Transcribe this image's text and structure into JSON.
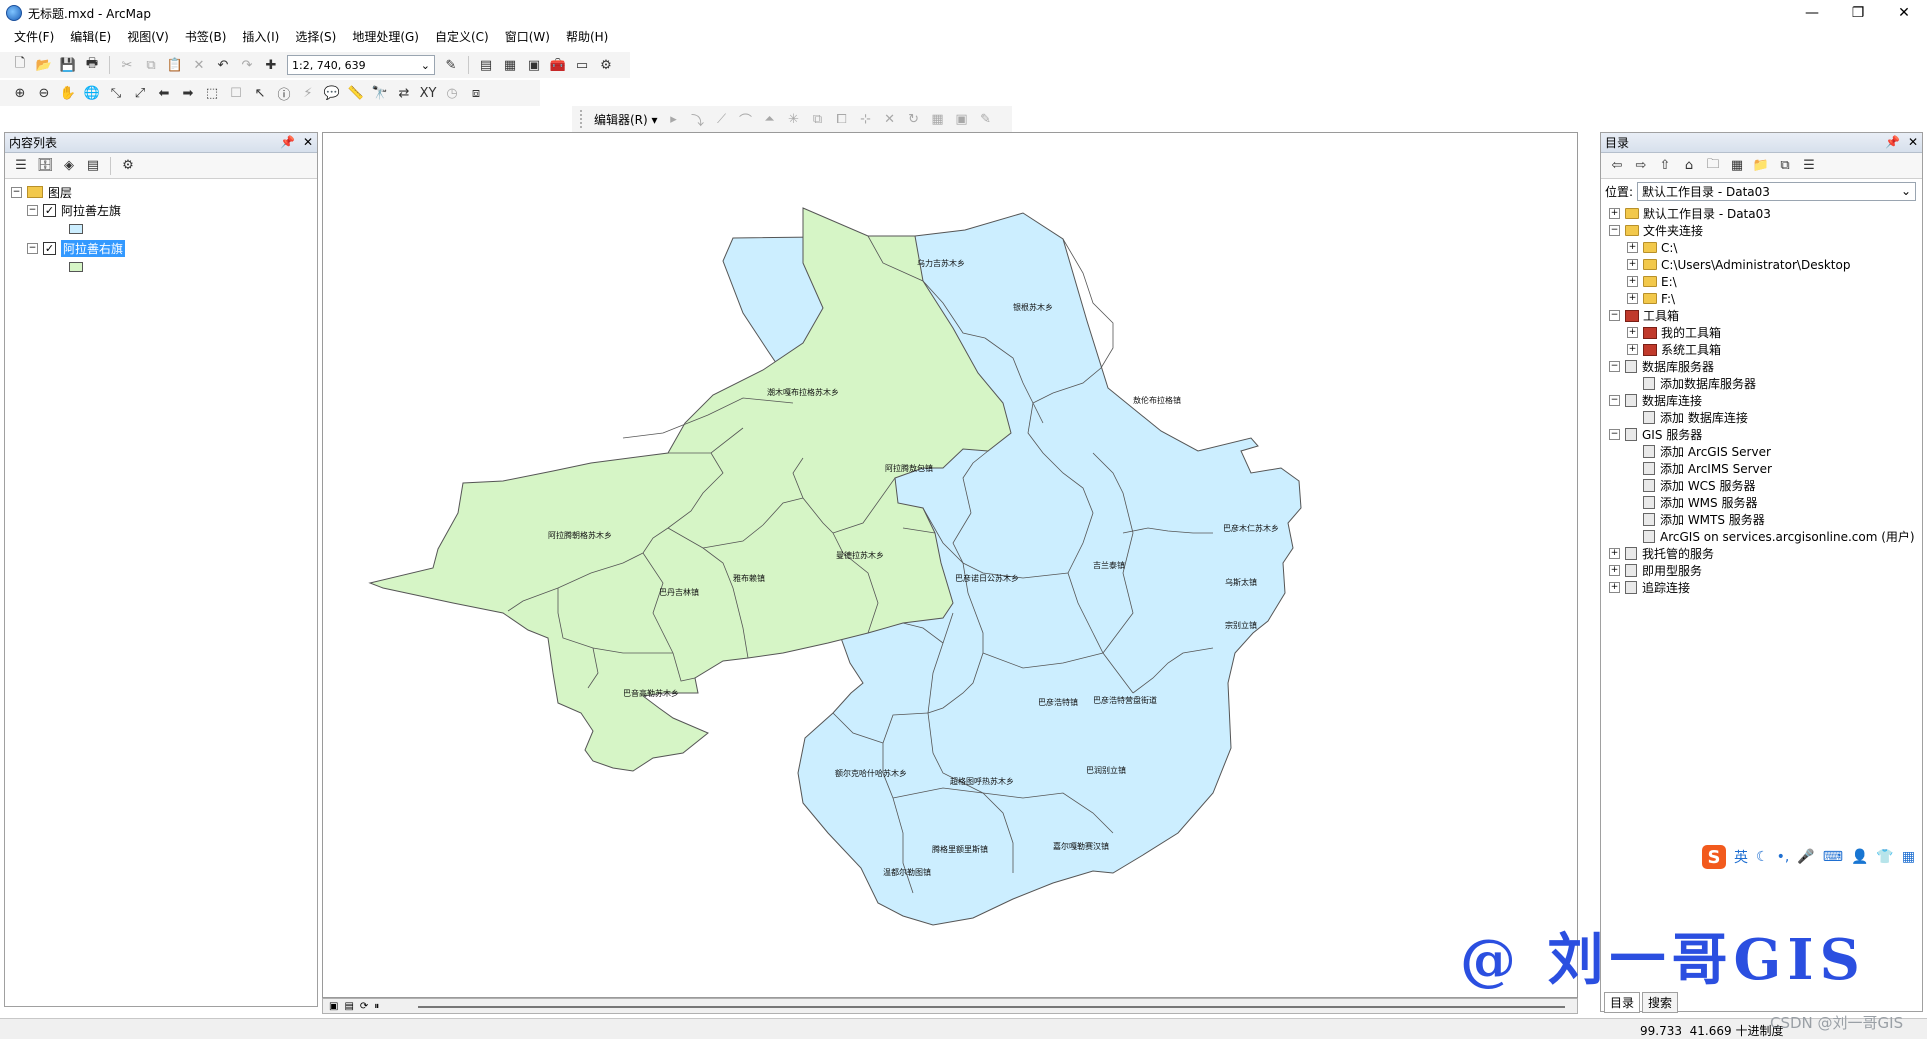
{
  "window": {
    "title": "无标题.mxd - ArcMap",
    "minimize": "—",
    "restore": "❐",
    "close": "✕"
  },
  "menu": [
    "文件(F)",
    "编辑(E)",
    "视图(V)",
    "书签(B)",
    "插入(I)",
    "选择(S)",
    "地理处理(G)",
    "自定义(C)",
    "窗口(W)",
    "帮助(H)"
  ],
  "toolbar": {
    "scale": "1:2, 740, 639",
    "editor_label": "编辑器(R) ▾"
  },
  "toc": {
    "title": "内容列表",
    "root_label": "图层",
    "layers": [
      {
        "name": "阿拉善左旗",
        "checked": true,
        "swatch": "#cceeff"
      },
      {
        "name": "阿拉善右旗",
        "checked": true,
        "swatch": "#d6f5c6",
        "selected": true
      }
    ]
  },
  "map": {
    "left_banner_color": "#d6f5c6",
    "right_banner_color": "#cceeff",
    "labels": [
      "乌力吉苏木乡",
      "银根苏木乡",
      "敖伦布拉格镇",
      "潮木嘎布拉格苏木乡",
      "阿拉腾敖包镇",
      "阿拉腾朝格苏木乡",
      "雅布赖镇",
      "曼德拉苏木乡",
      "巴丹吉林镇",
      "巴音高勒苏木乡",
      "巴彦诺日公苏木乡",
      "吉兰泰镇",
      "巴彦木仁苏木乡",
      "乌斯太镇",
      "宗别立镇",
      "巴彦浩特镇",
      "巴彦浩特营盘街道",
      "额尔克哈什哈苏木乡",
      "超格图呼热苏木乡",
      "巴润别立镇",
      "腾格里额里斯镇",
      "嘉尔嘎勒赛汉镇",
      "温都尔勒图镇"
    ]
  },
  "catalog": {
    "title": "目录",
    "location_label": "位置:",
    "location_value": "默认工作目录 - Data03",
    "items": [
      {
        "label": "默认工作目录 - Data03",
        "level": 0,
        "icon": "folder",
        "exp": "+"
      },
      {
        "label": "文件夹连接",
        "level": 0,
        "icon": "folder",
        "exp": "−"
      },
      {
        "label": "C:\\",
        "level": 1,
        "icon": "folder",
        "exp": "+"
      },
      {
        "label": "C:\\Users\\Administrator\\Desktop",
        "level": 1,
        "icon": "folder",
        "exp": "+"
      },
      {
        "label": "E:\\",
        "level": 1,
        "icon": "folder",
        "exp": "+"
      },
      {
        "label": "F:\\",
        "level": 1,
        "icon": "folder",
        "exp": "+"
      },
      {
        "label": "工具箱",
        "level": 0,
        "icon": "toolbox",
        "exp": "−"
      },
      {
        "label": "我的工具箱",
        "level": 1,
        "icon": "toolbox",
        "exp": "+"
      },
      {
        "label": "系统工具箱",
        "level": 1,
        "icon": "toolbox",
        "exp": "+"
      },
      {
        "label": "数据库服务器",
        "level": 0,
        "icon": "server",
        "exp": "−"
      },
      {
        "label": "添加数据库服务器",
        "level": 1,
        "icon": "server",
        "exp": ""
      },
      {
        "label": "数据库连接",
        "level": 0,
        "icon": "server",
        "exp": "−"
      },
      {
        "label": "添加 数据库连接",
        "level": 1,
        "icon": "server",
        "exp": ""
      },
      {
        "label": "GIS 服务器",
        "level": 0,
        "icon": "server",
        "exp": "−"
      },
      {
        "label": "添加 ArcGIS Server",
        "level": 1,
        "icon": "server",
        "exp": ""
      },
      {
        "label": "添加 ArcIMS Server",
        "level": 1,
        "icon": "server",
        "exp": ""
      },
      {
        "label": "添加 WCS 服务器",
        "level": 1,
        "icon": "server",
        "exp": ""
      },
      {
        "label": "添加 WMS 服务器",
        "level": 1,
        "icon": "server",
        "exp": ""
      },
      {
        "label": "添加 WMTS 服务器",
        "level": 1,
        "icon": "server",
        "exp": ""
      },
      {
        "label": "ArcGIS on services.arcgisonline.com (用户)",
        "level": 1,
        "icon": "server",
        "exp": ""
      },
      {
        "label": "我托管的服务",
        "level": 0,
        "icon": "server",
        "exp": "+"
      },
      {
        "label": "即用型服务",
        "level": 0,
        "icon": "server",
        "exp": "+"
      },
      {
        "label": "追踪连接",
        "level": 0,
        "icon": "server",
        "exp": "+"
      }
    ],
    "tabs": [
      "目录",
      "搜索"
    ]
  },
  "status": {
    "x": "99.733",
    "y": "41.669",
    "units": "十进制度"
  },
  "ime": {
    "logo": "S",
    "lang": "英"
  },
  "watermarks": {
    "overlay": "@ 刘一哥GIS",
    "csdn": "CSDN @刘一哥GIS"
  }
}
